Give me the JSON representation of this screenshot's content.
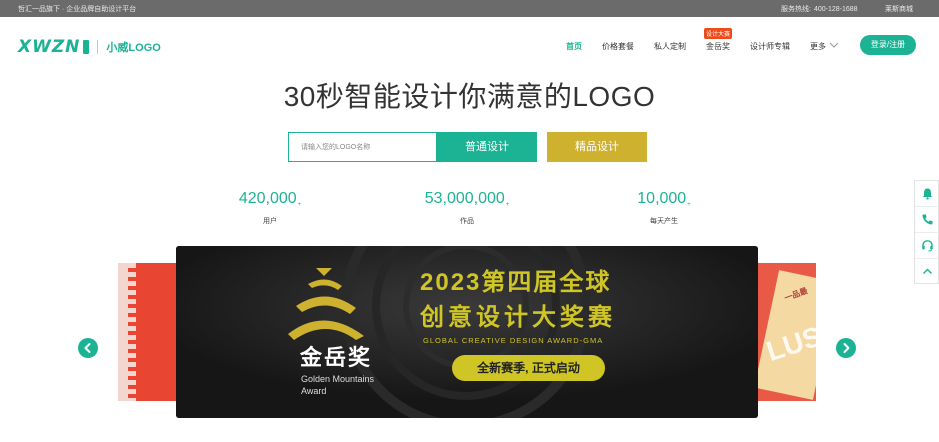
{
  "topbar": {
    "tagline": "哲汇一品旗下 · 企业品牌自助设计平台",
    "hotline_label": "服务热线:",
    "hotline_number": "400-128-1688",
    "mall_link": "莱斯商城"
  },
  "header": {
    "logo_mark": "XWZN",
    "logo_text": "小威LOGO",
    "nav": {
      "home": "首页",
      "pricing": "价格套餐",
      "custom": "私人定制",
      "award": "金岳奖",
      "award_badge": "设计大赛",
      "designers": "设计师专辑",
      "more": "更多"
    },
    "login_label": "登录/注册"
  },
  "hero": {
    "title": "30秒智能设计你满意的LOGO",
    "search_placeholder": "请输入您的LOGO名称",
    "btn_normal": "普通设计",
    "btn_premium": "精品设计"
  },
  "stats": [
    {
      "value": "420,000",
      "suffix": "+",
      "label": "用户"
    },
    {
      "value": "53,000,000",
      "suffix": "+",
      "label": "作品"
    },
    {
      "value": "10,000",
      "suffix": "+",
      "label": "每天产生"
    }
  ],
  "banner": {
    "title_line1": "2023第四届全球",
    "title_line2": "创意设计大奖赛",
    "subtitle": "GLOBAL CREATIVE DESIGN AWARD-GMA",
    "pill": "全新赛季, 正式启动",
    "award_cn": "金岳奖",
    "award_en_line1": "Golden Mountains",
    "award_en_line2": "Award"
  },
  "side_card_right": {
    "stamp_text": "一品最",
    "big_text": "LUSI"
  },
  "colors": {
    "brand": "#1cb395",
    "gold": "#cdb12f",
    "banner_accent": "#cfc524",
    "badge": "#f04a1a"
  },
  "icons": {
    "carousel_prev": "chevron-left-icon",
    "carousel_next": "chevron-right-icon",
    "float": [
      "bell-icon",
      "phone-icon",
      "headset-icon",
      "chevron-up-icon"
    ]
  }
}
